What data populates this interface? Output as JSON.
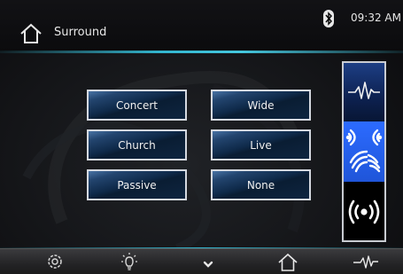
{
  "header": {
    "title": "Surround",
    "time": "09:32 AM"
  },
  "modes": [
    {
      "label": "Concert"
    },
    {
      "label": "Wide"
    },
    {
      "label": "Church"
    },
    {
      "label": "Live"
    },
    {
      "label": "Passive"
    },
    {
      "label": "None"
    }
  ],
  "side_panel": {
    "items": [
      {
        "icon": "waveform-icon"
      },
      {
        "icon": "surround-waves-icon",
        "selected": true
      },
      {
        "icon": "broadcast-icon"
      }
    ]
  },
  "bottom_bar": {
    "items": [
      {
        "icon": "gear-icon"
      },
      {
        "icon": "bulb-icon"
      },
      {
        "icon": "chevron-down-icon"
      },
      {
        "icon": "home-icon"
      },
      {
        "icon": "waveform-icon"
      }
    ]
  },
  "colors": {
    "accent": "#33b6cf",
    "selected_blue": "#2c6bff",
    "button_blue": "#0f2a4a"
  }
}
